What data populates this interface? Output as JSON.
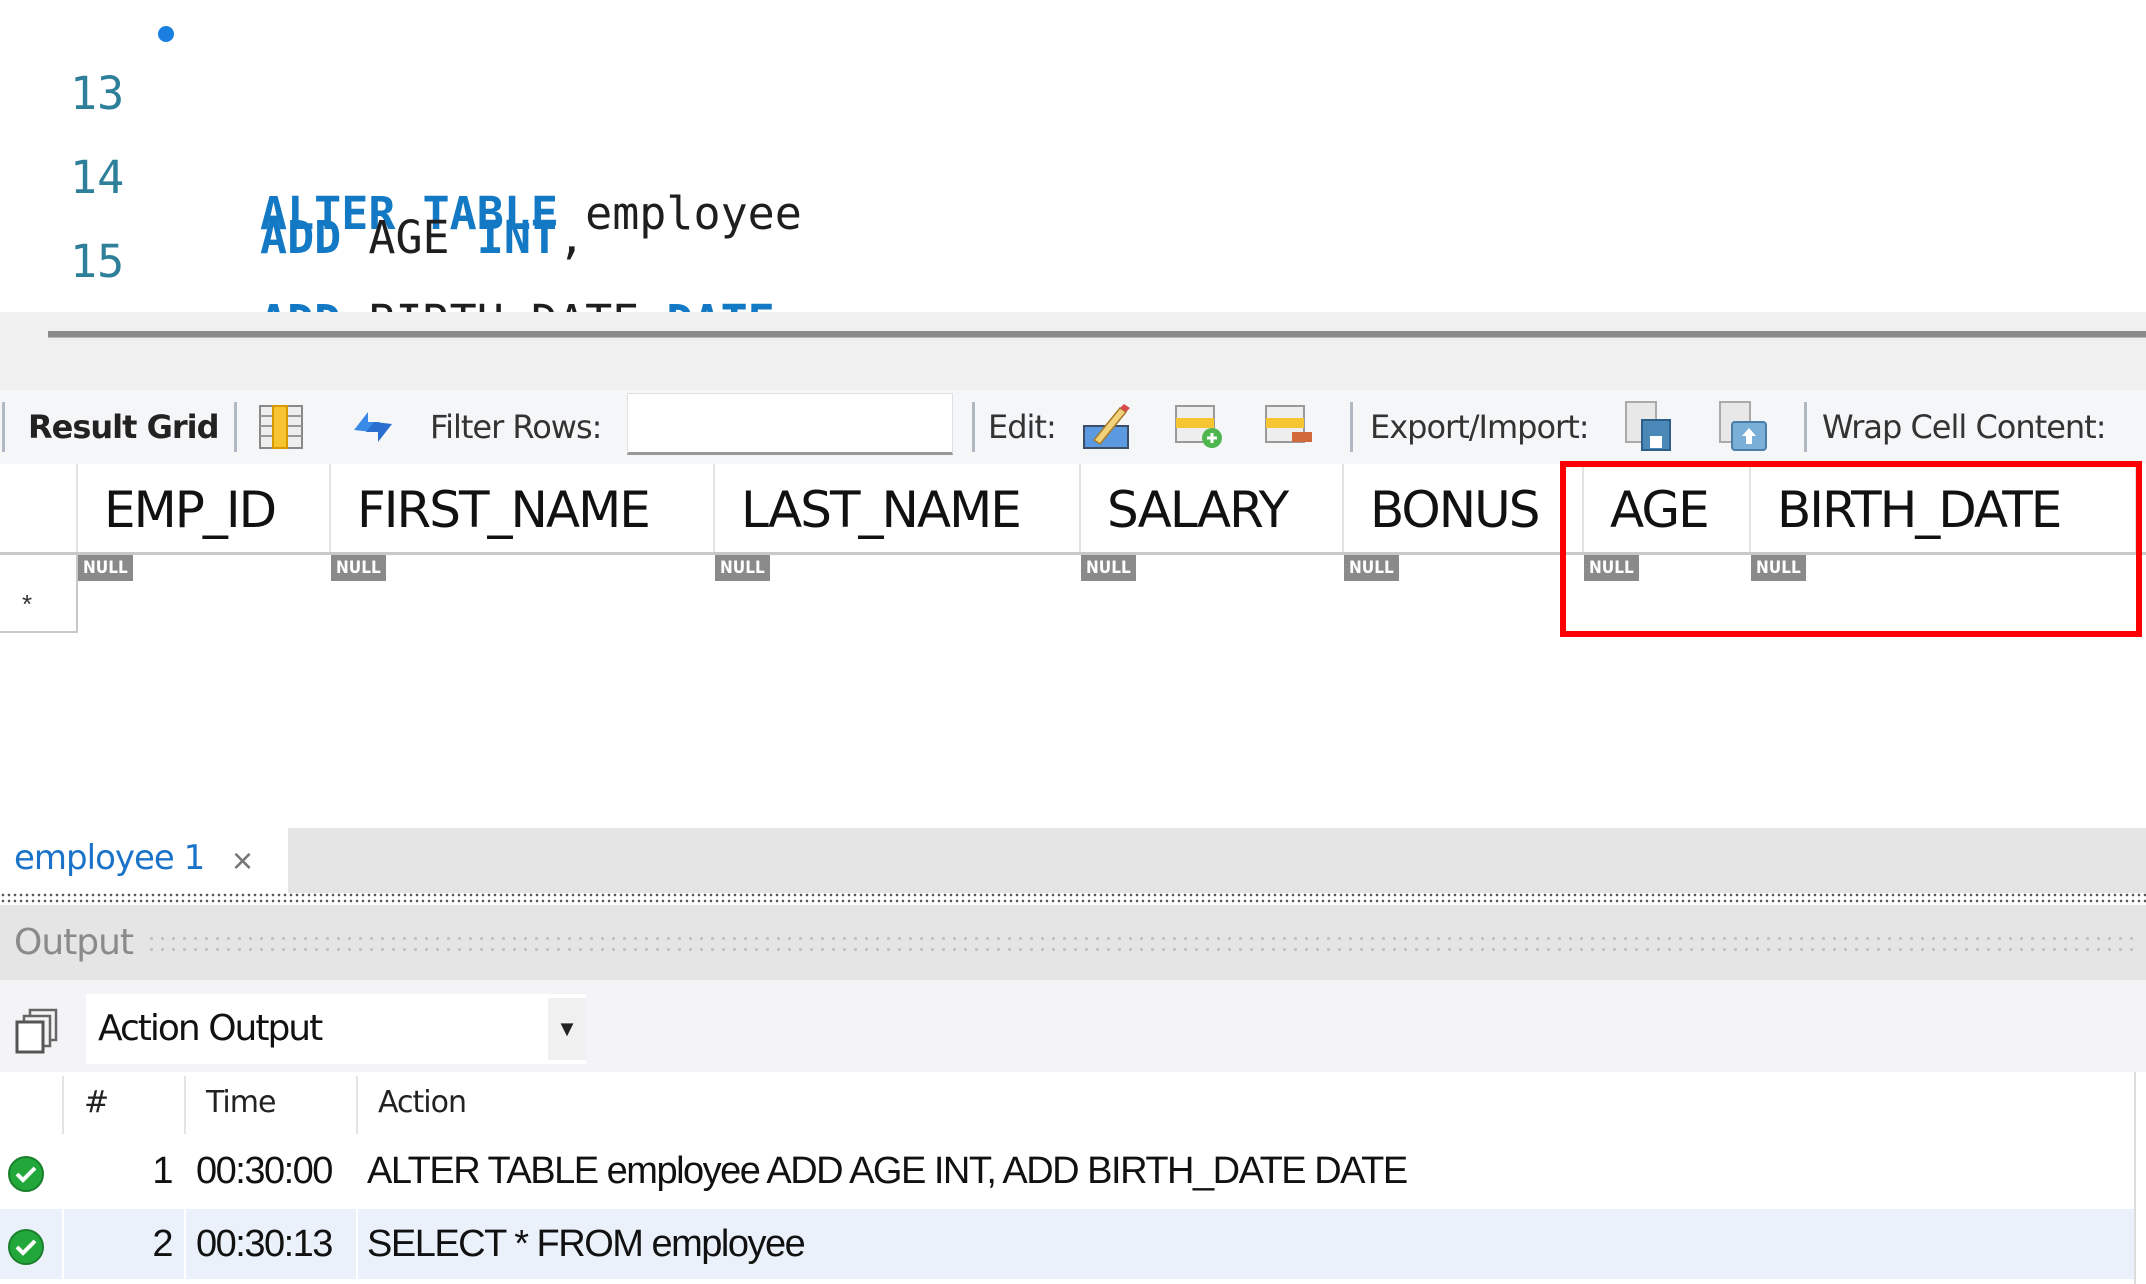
{
  "editor": {
    "lines": [
      {
        "number": "13",
        "has_marker": true,
        "tokens": [
          {
            "text": "ALTER TABLE",
            "kw": true
          },
          {
            "text": " employee",
            "kw": false
          }
        ]
      },
      {
        "number": "14",
        "has_marker": false,
        "tokens": [
          {
            "text": "ADD",
            "kw": true
          },
          {
            "text": " AGE ",
            "kw": false
          },
          {
            "text": "INT",
            "kw": true
          },
          {
            "text": ",",
            "kw": false
          }
        ]
      },
      {
        "number": "15",
        "has_marker": false,
        "tokens": [
          {
            "text": "ADD",
            "kw": true
          },
          {
            "text": " BIRTH_DATE ",
            "kw": false
          },
          {
            "text": "DATE",
            "kw": true
          },
          {
            "text": ";",
            "kw": false
          }
        ]
      }
    ]
  },
  "toolbar": {
    "result_grid_label": "Result Grid",
    "filter_rows_label": "Filter Rows:",
    "filter_rows_value": "",
    "edit_label": "Edit:",
    "export_import_label": "Export/Import:",
    "wrap_cell_label": "Wrap Cell Content:",
    "icons": [
      "grid-layout-icon",
      "refresh-icon",
      "edit-cell-icon",
      "add-row-icon",
      "delete-row-icon",
      "export-icon",
      "import-icon"
    ]
  },
  "grid": {
    "columns": [
      "EMP_ID",
      "FIRST_NAME",
      "LAST_NAME",
      "SALARY",
      "BONUS",
      "AGE",
      "BIRTH_DATE"
    ],
    "new_row_marker": "*",
    "null_label": "NULL",
    "highlighted_columns": [
      "AGE",
      "BIRTH_DATE"
    ],
    "highlight_color": "#ff0000"
  },
  "tabs": [
    {
      "label": "employee 1",
      "active": true,
      "close_glyph": "×"
    }
  ],
  "output": {
    "title": "Output",
    "selector_value": "Action Output",
    "columns": [
      "#",
      "Time",
      "Action"
    ],
    "rows": [
      {
        "num": "1",
        "time": "00:30:00",
        "action": "ALTER TABLE employee ADD AGE INT, ADD BIRTH_DATE DATE",
        "status": "success",
        "selected": false
      },
      {
        "num": "2",
        "time": "00:30:13",
        "action": "SELECT * FROM employee",
        "status": "success",
        "selected": true
      }
    ]
  },
  "colors": {
    "keyword": "#1479c4",
    "line_number": "#2e7f9a",
    "tab_active_text": "#1a73c8",
    "success": "#22a83a",
    "selected_row": "#eaf1fb"
  }
}
